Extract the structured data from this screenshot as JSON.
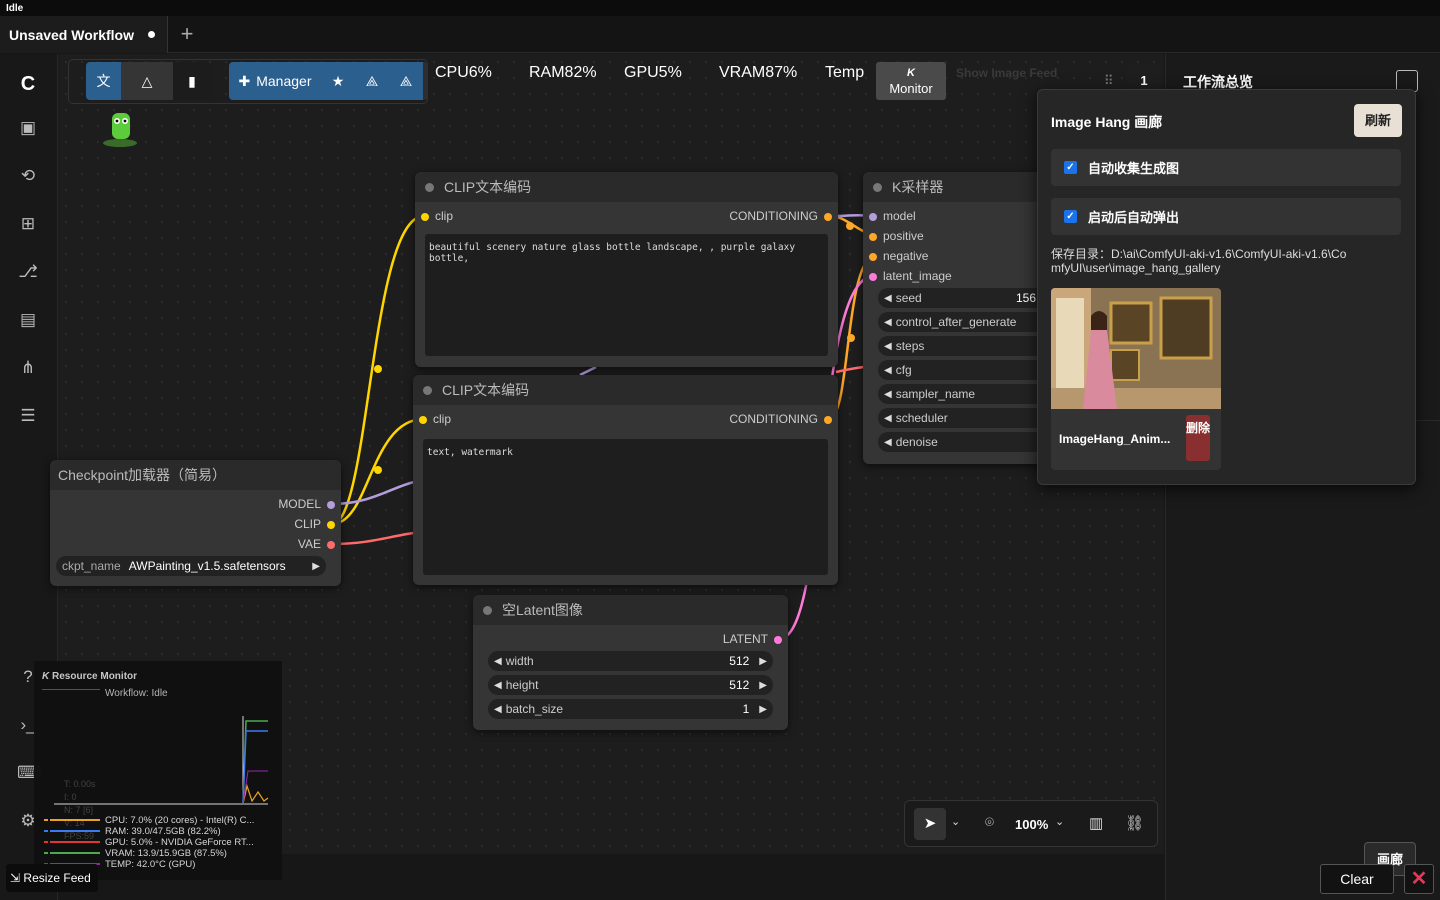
{
  "window": {
    "title": "Idle"
  },
  "tabs": {
    "active_label": "Unsaved Workflow",
    "new_tab": "+"
  },
  "toolbar": {
    "manager_label": "Manager",
    "stats": {
      "cpu": "CPU6%",
      "ram": "RAM82%",
      "gpu": "GPU5%",
      "vram": "VRAM87%",
      "temp": "Temp"
    },
    "monitor_label": "Monitor",
    "monitor_logo": "K",
    "show_feed_label": "Show Image Feed",
    "queue_count": "1"
  },
  "nodes": {
    "clip1": {
      "title": "CLIP文本编码",
      "input": "clip",
      "output": "CONDITIONING",
      "text": "beautiful scenery nature glass bottle landscape, , purple galaxy bottle,"
    },
    "clip2": {
      "title": "CLIP文本编码",
      "input": "clip",
      "output": "CONDITIONING",
      "text": "text, watermark"
    },
    "ksampler": {
      "title": "K采样器",
      "inputs": [
        "model",
        "positive",
        "negative",
        "latent_image"
      ],
      "widgets": [
        {
          "name": "seed",
          "value": "156"
        },
        {
          "name": "control_after_generate",
          "value": ""
        },
        {
          "name": "steps",
          "value": ""
        },
        {
          "name": "cfg",
          "value": ""
        },
        {
          "name": "sampler_name",
          "value": ""
        },
        {
          "name": "scheduler",
          "value": ""
        },
        {
          "name": "denoise",
          "value": ""
        }
      ]
    },
    "checkpoint": {
      "title": "Checkpoint加载器（简易）",
      "outputs": [
        "MODEL",
        "CLIP",
        "VAE"
      ],
      "ckpt_label": "ckpt_name",
      "ckpt_value": "AWPainting_v1.5.safetensors"
    },
    "latent": {
      "title": "空Latent图像",
      "output": "LATENT",
      "widgets": [
        {
          "name": "width",
          "value": "512"
        },
        {
          "name": "height",
          "value": "512"
        },
        {
          "name": "batch_size",
          "value": "1"
        }
      ]
    }
  },
  "right_panel": {
    "title": "工作流总览"
  },
  "gallery": {
    "title": "Image Hang 画廊",
    "refresh": "刷新",
    "auto_collect": "自动收集生成图",
    "auto_popup": "启动后自动弹出",
    "save_dir": "保存目录：D:\\ai\\ComfyUI-aki-v1.6\\ComfyUI-aki-v1.6\\ComfyUI\\user\\image_hang_gallery",
    "item_name": "ImageHang_Anim...",
    "delete": "删除"
  },
  "resource_monitor": {
    "title": "Resource Monitor",
    "workflow_status": "Workflow: Idle",
    "t_label": "T: 0.00s",
    "i_label": "I: 0",
    "n_label": "N: 7 [6]",
    "v_label": "V: 14",
    "fps_label": "FPS:59",
    "cpu": "CPU: 7.0% (20 cores) - Intel(R) C...",
    "ram": "RAM: 39.0/47.5GB (82.2%)",
    "gpu": "GPU: 5.0% - NVIDIA GeForce RT...",
    "vram": "VRAM: 13.9/15.9GB (87.5%)",
    "temp": "TEMP: 42.0°C (GPU)",
    "colors": {
      "cpu": "#f5a623",
      "ram": "#3d7ef5",
      "gpu": "#e53935",
      "vram": "#4caf50",
      "temp": "#9c27b0"
    }
  },
  "bottom": {
    "resize_feed": "Resize Feed",
    "clear": "Clear",
    "gallery_btn": "画廊"
  },
  "canvas_controls": {
    "zoom": "100%"
  }
}
